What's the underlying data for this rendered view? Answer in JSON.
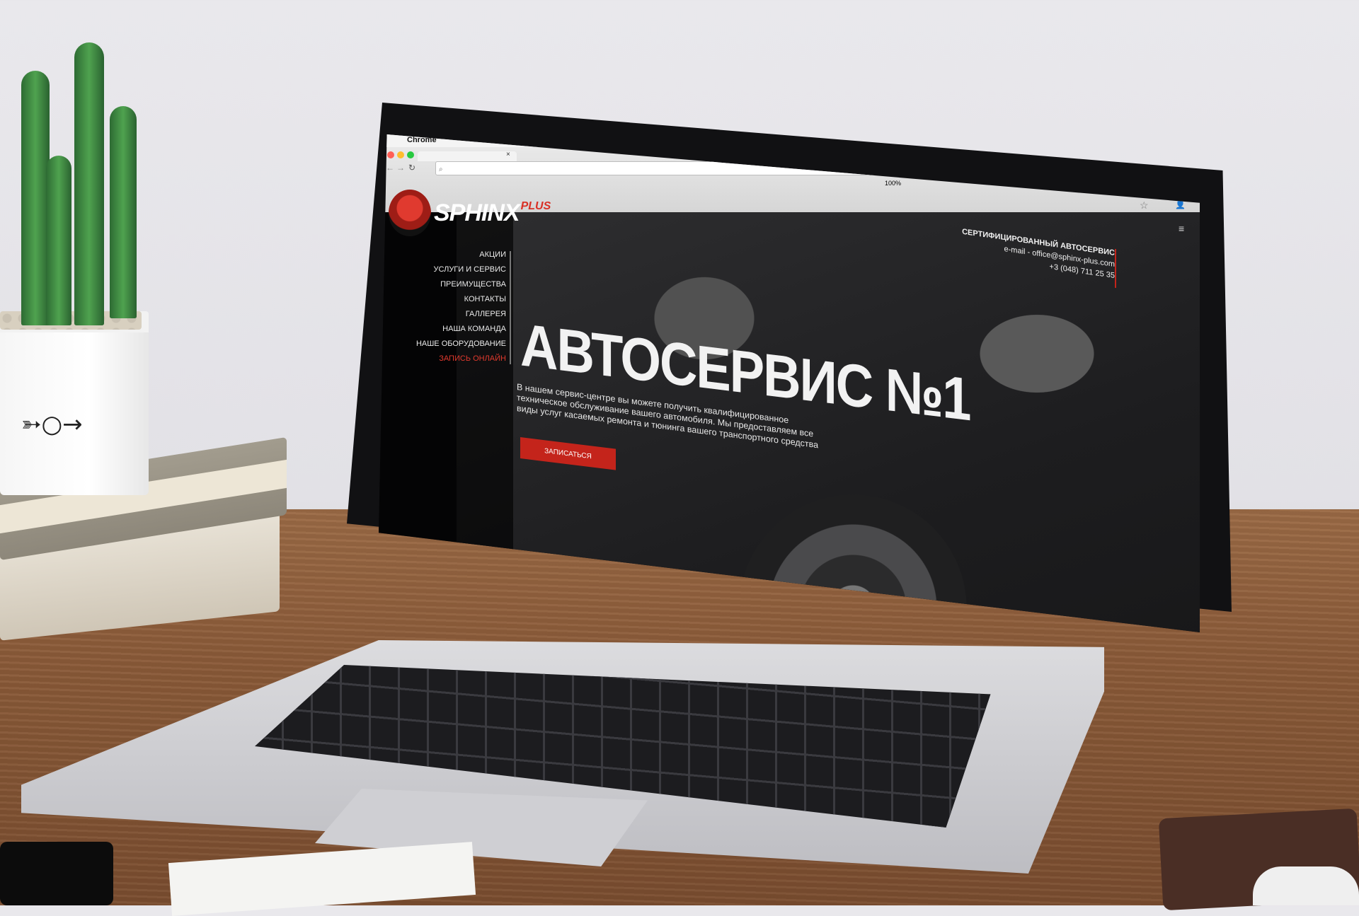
{
  "browser": {
    "app_name": "Chrome",
    "status_battery": "100%"
  },
  "site": {
    "logo_text": "SPHINX",
    "logo_suffix": "PLUS",
    "menu": [
      {
        "label": "АКЦИИ"
      },
      {
        "label": "УСЛУГИ И СЕРВИС"
      },
      {
        "label": "ПРЕИМУЩЕСТВА"
      },
      {
        "label": "КОНТАКТЫ"
      },
      {
        "label": "ГАЛЛЕРЕЯ"
      },
      {
        "label": "НАША КОМАНДА"
      },
      {
        "label": "НАШЕ ОБОРУДОВАНИЕ"
      },
      {
        "label": "ЗАПИСЬ ОНЛАЙН"
      }
    ],
    "headline": "АВТОСЕРВИС №1",
    "lead": "В нашем сервис-центре вы можете получить квалифицированное техническое обслуживание вашего автомобиля. Мы предоставляем все виды услуг касаемых ремонта и тюнинга вашего транспортного средства",
    "cta_label": "ЗАПИСАТЬСЯ",
    "contact": {
      "title": "СЕРТИФИЦИРОВАННЫЙ АВТОСЕРВИС",
      "email": "e-mail  -  office@sphinx-plus.com",
      "phone": "+3 (048) 711 25 35"
    }
  },
  "colors": {
    "accent": "#c4241b",
    "menu_active": "#e0392d"
  }
}
